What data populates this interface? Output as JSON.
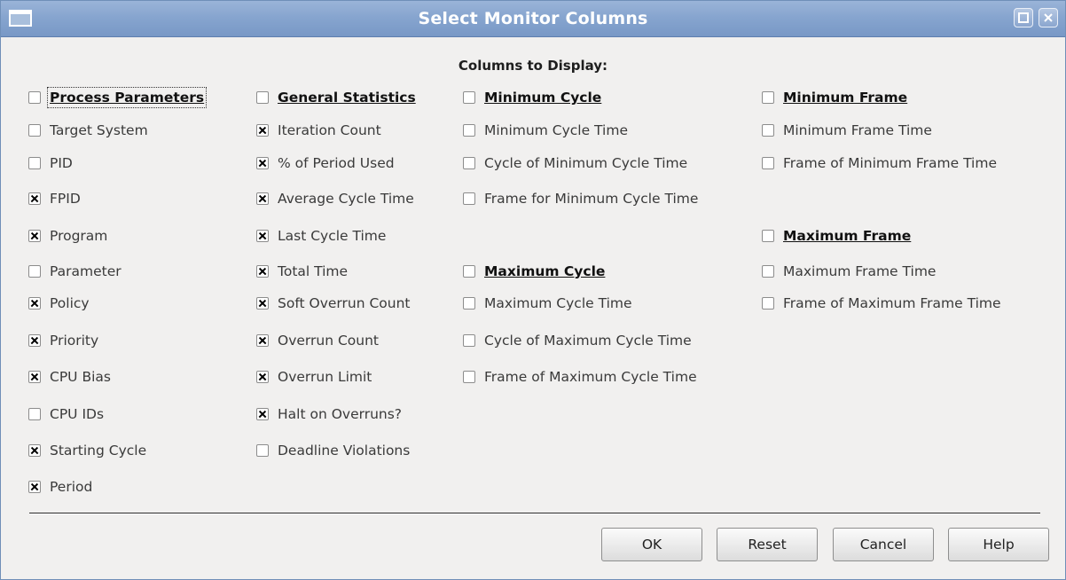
{
  "window": {
    "title": "Select Monitor Columns"
  },
  "section_title": "Columns to Display:",
  "columns": [
    [
      {
        "label": "Process Parameters",
        "checked": false,
        "header": true,
        "focus": true
      },
      {
        "label": "Target System",
        "checked": false
      },
      {
        "label": "PID",
        "checked": false
      },
      {
        "label": "FPID",
        "checked": true
      },
      {
        "label": "Program",
        "checked": true
      },
      {
        "label": "Parameter",
        "checked": false
      },
      {
        "label": "Policy",
        "checked": true
      },
      {
        "label": "Priority",
        "checked": true
      },
      {
        "label": "CPU Bias",
        "checked": true
      },
      {
        "label": "CPU IDs",
        "checked": false
      },
      {
        "label": "Starting Cycle",
        "checked": true
      },
      {
        "label": "Period",
        "checked": true
      }
    ],
    [
      {
        "label": "General Statistics",
        "checked": false,
        "header": true
      },
      {
        "label": "Iteration Count",
        "checked": true
      },
      {
        "label": "% of Period Used",
        "checked": true
      },
      {
        "label": "Average Cycle Time",
        "checked": true
      },
      {
        "label": "Last Cycle Time",
        "checked": true
      },
      {
        "label": "Total Time",
        "checked": true
      },
      {
        "label": "Soft Overrun Count",
        "checked": true
      },
      {
        "label": "Overrun Count",
        "checked": true
      },
      {
        "label": "Overrun Limit",
        "checked": true
      },
      {
        "label": "Halt on Overruns?",
        "checked": true
      },
      {
        "label": "Deadline Violations",
        "checked": false
      }
    ],
    [
      {
        "label": "Minimum Cycle",
        "checked": false,
        "header": true
      },
      {
        "label": "Minimum Cycle Time",
        "checked": false
      },
      {
        "label": "Cycle of Minimum Cycle Time",
        "checked": false
      },
      {
        "label": "Frame for Minimum Cycle Time",
        "checked": false
      },
      {
        "label": "Maximum Cycle",
        "checked": false,
        "header": true
      },
      {
        "label": "Maximum Cycle Time",
        "checked": false
      },
      {
        "label": "Cycle of Maximum Cycle Time",
        "checked": false
      },
      {
        "label": "Frame of Maximum Cycle Time",
        "checked": false
      }
    ],
    [
      {
        "label": "Minimum Frame",
        "checked": false,
        "header": true
      },
      {
        "label": "Minimum Frame Time",
        "checked": false
      },
      {
        "label": "Frame of Minimum Frame Time",
        "checked": false
      },
      {
        "label": "Maximum Frame",
        "checked": false,
        "header": true
      },
      {
        "label": "Maximum Frame Time",
        "checked": false
      },
      {
        "label": "Frame of Maximum Frame Time",
        "checked": false
      }
    ]
  ],
  "buttons": {
    "ok": "OK",
    "reset": "Reset",
    "cancel": "Cancel",
    "help": "Help"
  }
}
